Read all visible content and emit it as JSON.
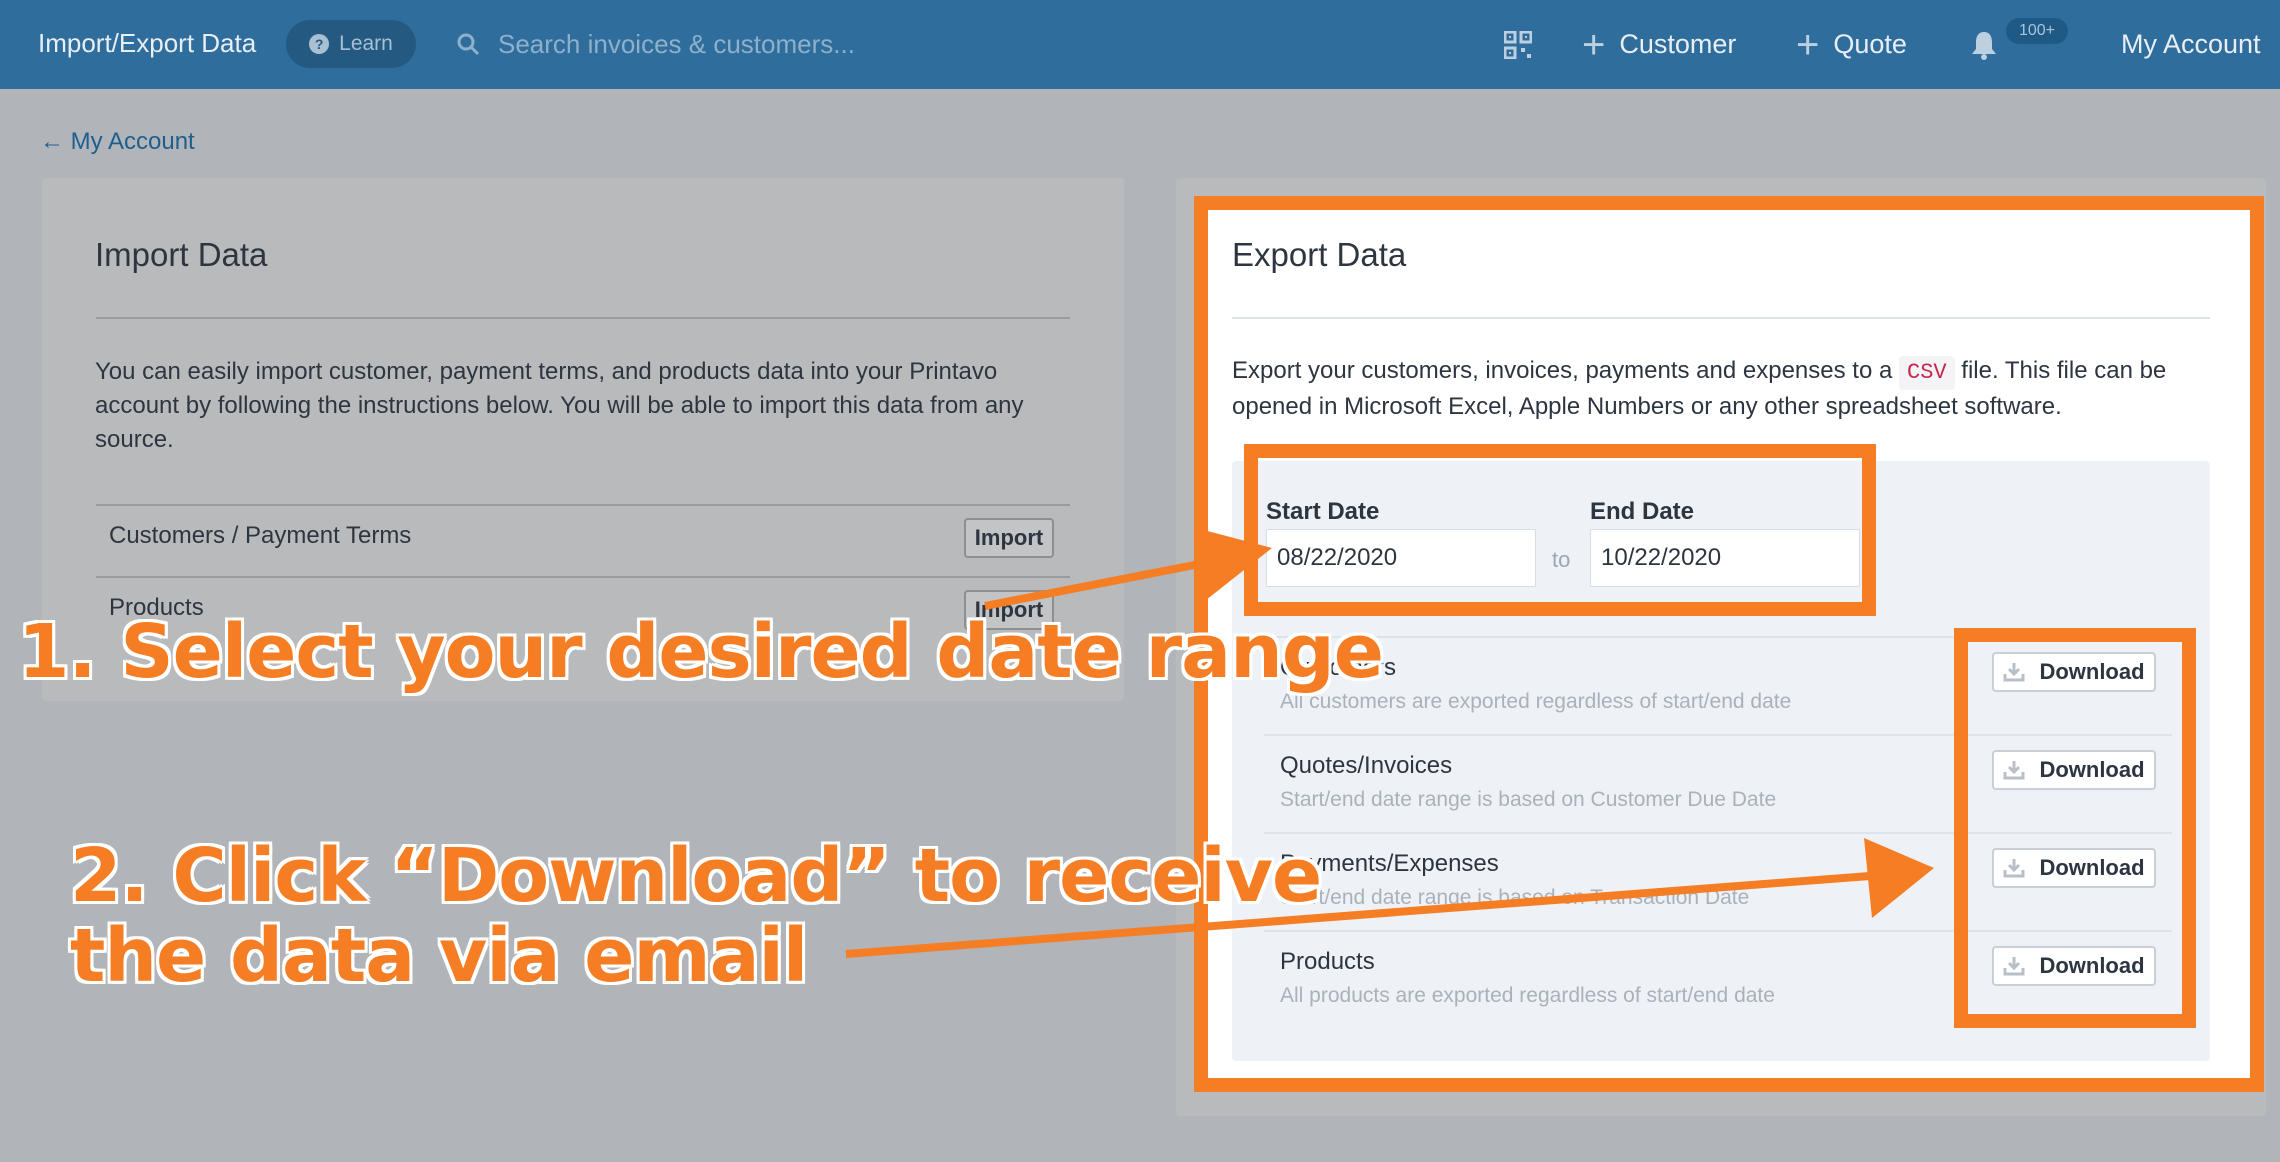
{
  "topbar": {
    "title": "Import/Export Data",
    "learn_label": "Learn",
    "search_placeholder": "Search invoices & customers...",
    "customer_label": "Customer",
    "quote_label": "Quote",
    "notifications_badge": "100+",
    "account_label": "My Account"
  },
  "back_link": "← My Account",
  "import": {
    "title": "Import Data",
    "description": "You can easily import customer, payment terms, and products data into your Printavo account by following the instructions below. You will be able to import this data from any source.",
    "rows": [
      {
        "label": "Customers / Payment Terms",
        "button": "Import"
      },
      {
        "label": "Products",
        "button": "Import"
      }
    ]
  },
  "export": {
    "title": "Export Data",
    "description_before": "Export your customers, invoices, payments and expenses to a",
    "csv_code": "CSV",
    "description_after": "file. This file can be opened in Microsoft Excel, Apple Numbers or any other spreadsheet software.",
    "start_date_label": "Start Date",
    "start_date_value": "08/22/2020",
    "to_label": "to",
    "end_date_label": "End Date",
    "end_date_value": "10/22/2020",
    "rows": [
      {
        "title": "Customers",
        "sub": "All customers are exported regardless of start/end date",
        "button": "Download"
      },
      {
        "title": "Quotes/Invoices",
        "sub": "Start/end date range is based on Customer Due Date",
        "button": "Download"
      },
      {
        "title": "Payments/Expenses",
        "sub": "Start/end date range is based on Transaction Date",
        "button": "Download"
      },
      {
        "title": "Products",
        "sub": "All products are exported regardless of start/end date",
        "button": "Download"
      }
    ]
  },
  "annotations": {
    "step1": "1. Select your desired date range",
    "step2_line1": "2. Click “Download” to receive",
    "step2_line2": "the data via email"
  },
  "colors": {
    "topbar": "#2f6d9c",
    "annotation_orange": "#f57d24",
    "csv_red": "#c7254e"
  }
}
